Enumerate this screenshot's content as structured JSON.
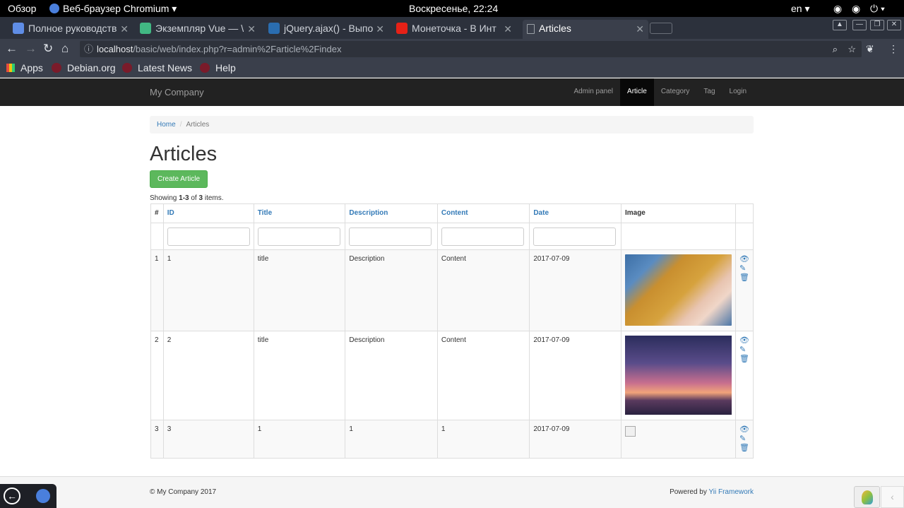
{
  "os": {
    "overview": "Обзор",
    "app_name": "Веб-браузер Chromium",
    "clock": "Воскресенье, 22:24",
    "lang": "en"
  },
  "browser": {
    "tabs": [
      {
        "label": "Полное руководств",
        "color": "#5f8de6"
      },
      {
        "label": "Экземпляр Vue — \\",
        "color": "#41b883"
      },
      {
        "label": "jQuery.ajax() - Выпо",
        "color": "#2a6db0"
      },
      {
        "label": "Монеточка - В Инт",
        "color": "#e62117"
      },
      {
        "label": "Articles",
        "color": "#cfd3da"
      }
    ],
    "url_host": "localhost",
    "url_path": "/basic/web/index.php?r=admin%2Farticle%2Findex",
    "bookmarks": [
      "Apps",
      "Debian.org",
      "Latest News",
      "Help"
    ]
  },
  "site": {
    "brand": "My Company",
    "nav": [
      "Admin panel",
      "Article",
      "Category",
      "Tag",
      "Login"
    ],
    "breadcrumb_home": "Home",
    "breadcrumb_current": "Articles",
    "title": "Articles",
    "create_button": "Create Article",
    "summary_prefix": "Showing ",
    "summary_range": "1-3",
    "summary_mid": " of ",
    "summary_total": "3",
    "summary_suffix": " items."
  },
  "table": {
    "headers": [
      "#",
      "ID",
      "Title",
      "Description",
      "Content",
      "Date",
      "Image"
    ],
    "rows": [
      {
        "num": "1",
        "id": "1",
        "title": "title",
        "description": "Description",
        "content": "Content",
        "date": "2017-07-09"
      },
      {
        "num": "2",
        "id": "2",
        "title": "title",
        "description": "Description",
        "content": "Content",
        "date": "2017-07-09"
      },
      {
        "num": "3",
        "id": "3",
        "title": "1",
        "description": "1",
        "content": "1",
        "date": "2017-07-09"
      }
    ]
  },
  "footer": {
    "copyright": "© My Company 2017",
    "powered_prefix": "Powered by ",
    "powered_link": "Yii Framework"
  }
}
